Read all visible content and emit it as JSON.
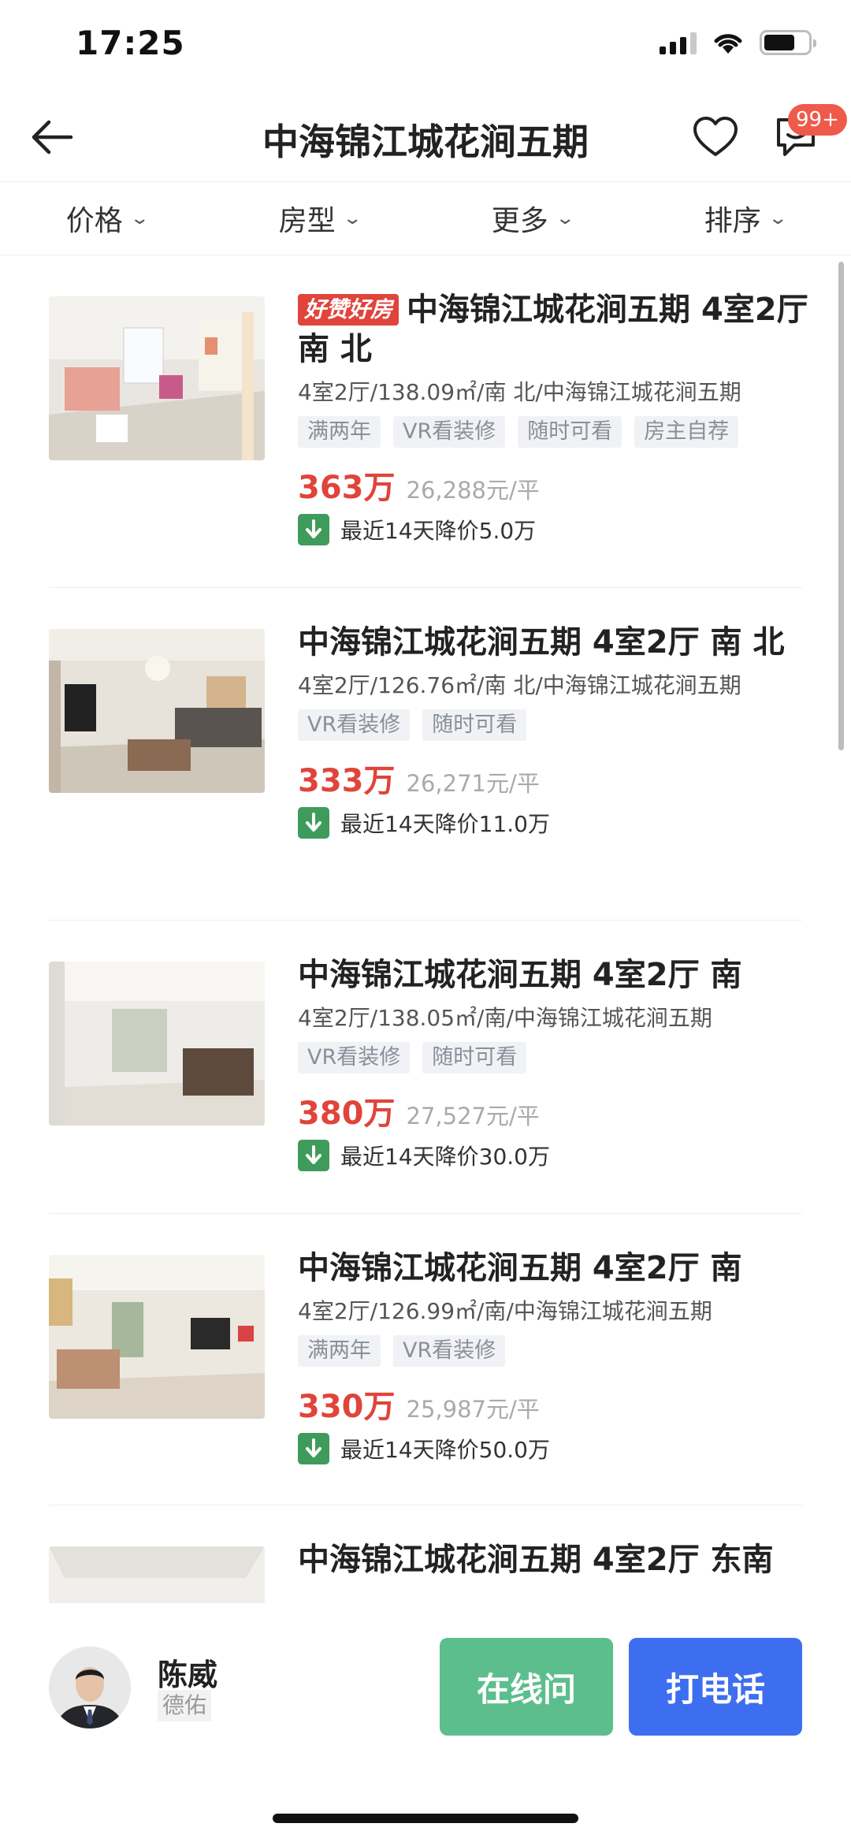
{
  "status_bar": {
    "time": "17:25"
  },
  "nav": {
    "title": "中海锦江城花涧五期",
    "badge": "99+"
  },
  "filters": [
    "价格",
    "房型",
    "更多",
    "排序"
  ],
  "listings": [
    {
      "badge": "好赞好房",
      "title": "中海锦江城花涧五期 4室2厅 南 北",
      "meta": "4室2厅/138.09㎡/南 北/中海锦江城花涧五期",
      "tags": [
        "满两年",
        "VR看装修",
        "随时可看",
        "房主自荐"
      ],
      "price": "363万",
      "unit_price": "26,288元/平",
      "drop": "最近14天降价5.0万"
    },
    {
      "title": "中海锦江城花涧五期 4室2厅 南 北",
      "meta": "4室2厅/126.76㎡/南 北/中海锦江城花涧五期",
      "tags": [
        "VR看装修",
        "随时可看"
      ],
      "price": "333万",
      "unit_price": "26,271元/平",
      "drop": "最近14天降价11.0万"
    },
    {
      "title": "中海锦江城花涧五期 4室2厅 南",
      "meta": "4室2厅/138.05㎡/南/中海锦江城花涧五期",
      "tags": [
        "VR看装修",
        "随时可看"
      ],
      "price": "380万",
      "unit_price": "27,527元/平",
      "drop": "最近14天降价30.0万"
    },
    {
      "title": "中海锦江城花涧五期 4室2厅 南",
      "meta": "4室2厅/126.99㎡/南/中海锦江城花涧五期",
      "tags": [
        "满两年",
        "VR看装修"
      ],
      "price": "330万",
      "unit_price": "25,987元/平",
      "drop": "最近14天降价50.0万"
    },
    {
      "title": "中海锦江城花涧五期 4室2厅 东南"
    }
  ],
  "agent": {
    "name": "陈威",
    "company": "德佑",
    "chat_label": "在线问",
    "call_label": "打电话"
  },
  "colors": {
    "price": "#e0443a",
    "chat": "#5cbe8d",
    "call": "#3e6ef0",
    "drop": "#3f9b5c"
  }
}
